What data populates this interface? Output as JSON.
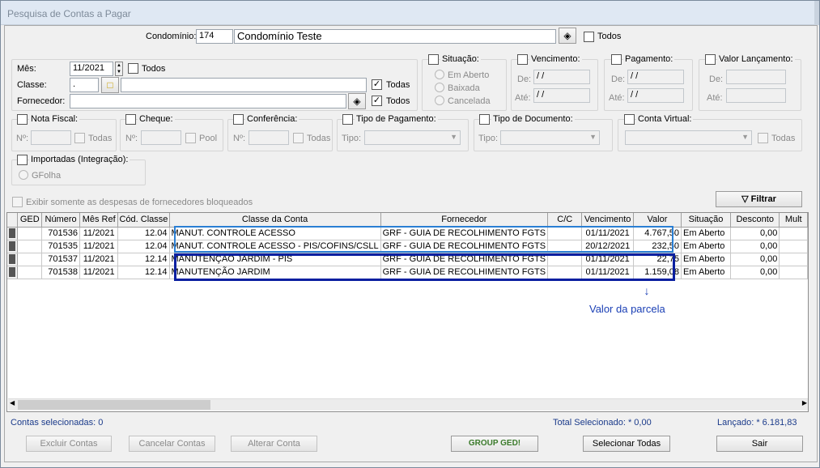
{
  "window": {
    "title": "Pesquisa de Contas a Pagar"
  },
  "condominio": {
    "label": "Condomínio:",
    "code": "174",
    "name": "Condomínio Teste",
    "todos_label": "Todos",
    "todos_checked": false
  },
  "filters": {
    "mes_label": "Mês:",
    "mes_value": "11/2021",
    "mes_todos_label": "Todos",
    "classe_label": "Classe:",
    "classe_value": ".",
    "classe_todas_label": "Todas",
    "classe_todas_checked": true,
    "fornecedor_label": "Fornecedor:",
    "fornecedor_todos_label": "Todos",
    "fornecedor_todos_checked": true,
    "situacao_label": "Situação:",
    "situacao_options": [
      "Em Aberto",
      "Baixada",
      "Cancelada"
    ],
    "vencimento_label": "Vencimento:",
    "pagamento_label": "Pagamento:",
    "valor_lancamento_label": "Valor Lançamento:",
    "de_label": "De:",
    "ate_label": "Até:",
    "date_placeholder": " / /",
    "nota_fiscal_label": "Nota Fiscal:",
    "cheque_label": "Cheque:",
    "conferencia_label": "Conferência:",
    "tipo_pagamento_label": "Tipo de Pagamento:",
    "tipo_documento_label": "Tipo de Documento:",
    "conta_virtual_label": "Conta Virtual:",
    "no_label": "Nº:",
    "todas_label": "Todas",
    "pool_label": "Pool",
    "tipo_label": "Tipo:",
    "importadas_label": "Importadas (Integração):",
    "gfolha_label": "GFolha",
    "bloqueados_label": "Exibir somente as despesas de fornecedores bloqueados",
    "filtrar_label": "Filtrar"
  },
  "grid": {
    "columns": [
      "",
      "GED",
      "Número",
      "Mês Ref",
      "Cód. Classe",
      "Classe da Conta",
      "Fornecedor",
      "C/C",
      "Vencimento",
      "Valor",
      "Situação",
      "Desconto",
      "Mult"
    ],
    "rows": [
      [
        "",
        "",
        "701536",
        "11/2021",
        "12.04",
        "MANUT. CONTROLE ACESSO",
        "GRF - GUIA DE RECOLHIMENTO FGTS",
        "",
        "01/11/2021",
        "4.767,50",
        "Em Aberto",
        "0,00",
        ""
      ],
      [
        "",
        "",
        "701535",
        "11/2021",
        "12.04",
        "MANUT. CONTROLE ACESSO - PIS/COFINS/CSLL",
        "GRF - GUIA DE RECOLHIMENTO FGTS",
        "",
        "20/12/2021",
        "232,50",
        "Em Aberto",
        "0,00",
        ""
      ],
      [
        "",
        "",
        "701537",
        "11/2021",
        "12.14",
        "MANUTENÇAO JARDIM - PIS",
        "GRF - GUIA DE RECOLHIMENTO FGTS",
        "",
        "01/11/2021",
        "22,75",
        "Em Aberto",
        "0,00",
        ""
      ],
      [
        "",
        "",
        "701538",
        "11/2021",
        "12.14",
        "MANUTENÇÃO JARDIM",
        "GRF - GUIA DE RECOLHIMENTO FGTS",
        "",
        "01/11/2021",
        "1.159,08",
        "Em Aberto",
        "0,00",
        ""
      ]
    ]
  },
  "annotation": {
    "text": "Valor da parcela",
    "color": "#1a3fb5"
  },
  "highlight_colors": {
    "light": "#2a7fd4",
    "dark": "#0a1fa0"
  },
  "footer": {
    "contas_selecionadas": "Contas selecionadas: 0",
    "total_selecionado": "Total Selecionado: * 0,00",
    "lancado": "Lançado: * 6.181,83",
    "excluir": "Excluir Contas",
    "cancelar": "Cancelar Contas",
    "alterar": "Alterar Conta",
    "group_ged": "GROUP GED!",
    "selecionar_todas": "Selecionar Todas",
    "sair": "Sair"
  }
}
